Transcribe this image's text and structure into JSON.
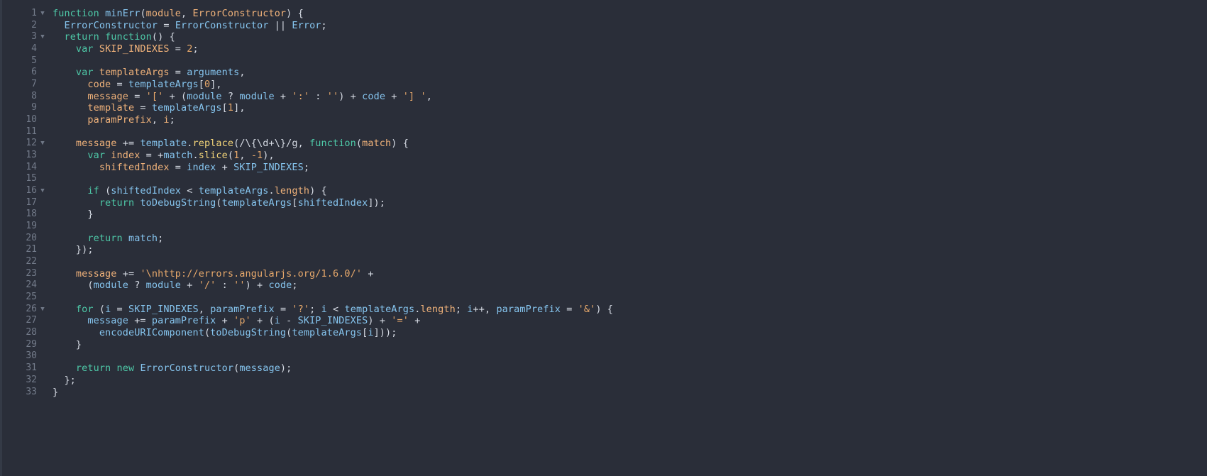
{
  "editor": {
    "language": "javascript",
    "total_lines": 33,
    "colors": {
      "background": "#2a2e39",
      "gutter_edge": "#343a46",
      "line_number": "#737b8a",
      "fold_arrow": "#6f7786",
      "keyword": "#4ec9a8",
      "identifier": "#86c5ef",
      "parameter": "#f0b27a",
      "method": "#f2d479",
      "string": "#e6a86b",
      "number": "#e6a86b",
      "punctuation": "#d6dbe4"
    },
    "fold_arrow_glyph": "▼",
    "folded_lines": [
      1,
      3,
      12,
      16,
      26
    ],
    "lines": [
      {
        "number": "1",
        "fold": true,
        "tokens": [
          {
            "text": "function ",
            "kind": "keyword"
          },
          {
            "text": "minErr",
            "kind": "identifier"
          },
          {
            "text": "(",
            "kind": "punctuation"
          },
          {
            "text": "module",
            "kind": "parameter"
          },
          {
            "text": ", ",
            "kind": "punctuation"
          },
          {
            "text": "ErrorConstructor",
            "kind": "parameter"
          },
          {
            "text": ") {",
            "kind": "punctuation"
          }
        ]
      },
      {
        "number": "2",
        "fold": false,
        "tokens": [
          {
            "text": "  ",
            "kind": "plain"
          },
          {
            "text": "ErrorConstructor",
            "kind": "identifier"
          },
          {
            "text": " = ",
            "kind": "punctuation"
          },
          {
            "text": "ErrorConstructor",
            "kind": "identifier"
          },
          {
            "text": " || ",
            "kind": "punctuation"
          },
          {
            "text": "Error",
            "kind": "identifier"
          },
          {
            "text": ";",
            "kind": "punctuation"
          }
        ]
      },
      {
        "number": "3",
        "fold": true,
        "tokens": [
          {
            "text": "  ",
            "kind": "plain"
          },
          {
            "text": "return ",
            "kind": "keyword"
          },
          {
            "text": "function",
            "kind": "keyword"
          },
          {
            "text": "() {",
            "kind": "punctuation"
          }
        ]
      },
      {
        "number": "4",
        "fold": false,
        "tokens": [
          {
            "text": "    ",
            "kind": "plain"
          },
          {
            "text": "var ",
            "kind": "keyword"
          },
          {
            "text": "SKIP_INDEXES",
            "kind": "parameter"
          },
          {
            "text": " = ",
            "kind": "punctuation"
          },
          {
            "text": "2",
            "kind": "number"
          },
          {
            "text": ";",
            "kind": "punctuation"
          }
        ]
      },
      {
        "number": "5",
        "fold": false,
        "tokens": []
      },
      {
        "number": "6",
        "fold": false,
        "tokens": [
          {
            "text": "    ",
            "kind": "plain"
          },
          {
            "text": "var ",
            "kind": "keyword"
          },
          {
            "text": "templateArgs",
            "kind": "parameter"
          },
          {
            "text": " = ",
            "kind": "punctuation"
          },
          {
            "text": "arguments",
            "kind": "identifier"
          },
          {
            "text": ",",
            "kind": "punctuation"
          }
        ]
      },
      {
        "number": "7",
        "fold": false,
        "tokens": [
          {
            "text": "      ",
            "kind": "plain"
          },
          {
            "text": "code",
            "kind": "parameter"
          },
          {
            "text": " = ",
            "kind": "punctuation"
          },
          {
            "text": "templateArgs",
            "kind": "identifier"
          },
          {
            "text": "[",
            "kind": "punctuation"
          },
          {
            "text": "0",
            "kind": "number"
          },
          {
            "text": "],",
            "kind": "punctuation"
          }
        ]
      },
      {
        "number": "8",
        "fold": false,
        "tokens": [
          {
            "text": "      ",
            "kind": "plain"
          },
          {
            "text": "message",
            "kind": "parameter"
          },
          {
            "text": " = ",
            "kind": "punctuation"
          },
          {
            "text": "'['",
            "kind": "string"
          },
          {
            "text": " + (",
            "kind": "punctuation"
          },
          {
            "text": "module",
            "kind": "identifier"
          },
          {
            "text": " ? ",
            "kind": "punctuation"
          },
          {
            "text": "module",
            "kind": "identifier"
          },
          {
            "text": " + ",
            "kind": "punctuation"
          },
          {
            "text": "':'",
            "kind": "string"
          },
          {
            "text": " : ",
            "kind": "punctuation"
          },
          {
            "text": "''",
            "kind": "string"
          },
          {
            "text": ") + ",
            "kind": "punctuation"
          },
          {
            "text": "code",
            "kind": "identifier"
          },
          {
            "text": " + ",
            "kind": "punctuation"
          },
          {
            "text": "'] '",
            "kind": "string"
          },
          {
            "text": ",",
            "kind": "punctuation"
          }
        ]
      },
      {
        "number": "9",
        "fold": false,
        "tokens": [
          {
            "text": "      ",
            "kind": "plain"
          },
          {
            "text": "template",
            "kind": "parameter"
          },
          {
            "text": " = ",
            "kind": "punctuation"
          },
          {
            "text": "templateArgs",
            "kind": "identifier"
          },
          {
            "text": "[",
            "kind": "punctuation"
          },
          {
            "text": "1",
            "kind": "number"
          },
          {
            "text": "],",
            "kind": "punctuation"
          }
        ]
      },
      {
        "number": "10",
        "fold": false,
        "tokens": [
          {
            "text": "      ",
            "kind": "plain"
          },
          {
            "text": "paramPrefix",
            "kind": "parameter"
          },
          {
            "text": ", ",
            "kind": "punctuation"
          },
          {
            "text": "i",
            "kind": "parameter"
          },
          {
            "text": ";",
            "kind": "punctuation"
          }
        ]
      },
      {
        "number": "11",
        "fold": false,
        "tokens": []
      },
      {
        "number": "12",
        "fold": true,
        "tokens": [
          {
            "text": "    ",
            "kind": "plain"
          },
          {
            "text": "message",
            "kind": "parameter"
          },
          {
            "text": " += ",
            "kind": "punctuation"
          },
          {
            "text": "template",
            "kind": "identifier"
          },
          {
            "text": ".",
            "kind": "punctuation"
          },
          {
            "text": "replace",
            "kind": "method"
          },
          {
            "text": "(/\\{\\d+\\}/g, ",
            "kind": "punctuation"
          },
          {
            "text": "function",
            "kind": "keyword"
          },
          {
            "text": "(",
            "kind": "punctuation"
          },
          {
            "text": "match",
            "kind": "parameter"
          },
          {
            "text": ") {",
            "kind": "punctuation"
          }
        ]
      },
      {
        "number": "13",
        "fold": false,
        "tokens": [
          {
            "text": "      ",
            "kind": "plain"
          },
          {
            "text": "var ",
            "kind": "keyword"
          },
          {
            "text": "index",
            "kind": "parameter"
          },
          {
            "text": " = +",
            "kind": "punctuation"
          },
          {
            "text": "match",
            "kind": "identifier"
          },
          {
            "text": ".",
            "kind": "punctuation"
          },
          {
            "text": "slice",
            "kind": "method"
          },
          {
            "text": "(",
            "kind": "punctuation"
          },
          {
            "text": "1",
            "kind": "number"
          },
          {
            "text": ", ",
            "kind": "punctuation"
          },
          {
            "text": "-1",
            "kind": "number"
          },
          {
            "text": "),",
            "kind": "punctuation"
          }
        ]
      },
      {
        "number": "14",
        "fold": false,
        "tokens": [
          {
            "text": "        ",
            "kind": "plain"
          },
          {
            "text": "shiftedIndex",
            "kind": "parameter"
          },
          {
            "text": " = ",
            "kind": "punctuation"
          },
          {
            "text": "index",
            "kind": "identifier"
          },
          {
            "text": " + ",
            "kind": "punctuation"
          },
          {
            "text": "SKIP_INDEXES",
            "kind": "identifier"
          },
          {
            "text": ";",
            "kind": "punctuation"
          }
        ]
      },
      {
        "number": "15",
        "fold": false,
        "tokens": []
      },
      {
        "number": "16",
        "fold": true,
        "tokens": [
          {
            "text": "      ",
            "kind": "plain"
          },
          {
            "text": "if ",
            "kind": "keyword"
          },
          {
            "text": "(",
            "kind": "punctuation"
          },
          {
            "text": "shiftedIndex",
            "kind": "identifier"
          },
          {
            "text": " < ",
            "kind": "punctuation"
          },
          {
            "text": "templateArgs",
            "kind": "identifier"
          },
          {
            "text": ".",
            "kind": "punctuation"
          },
          {
            "text": "length",
            "kind": "parameter"
          },
          {
            "text": ") {",
            "kind": "punctuation"
          }
        ]
      },
      {
        "number": "17",
        "fold": false,
        "tokens": [
          {
            "text": "        ",
            "kind": "plain"
          },
          {
            "text": "return ",
            "kind": "keyword"
          },
          {
            "text": "toDebugString",
            "kind": "identifier"
          },
          {
            "text": "(",
            "kind": "punctuation"
          },
          {
            "text": "templateArgs",
            "kind": "identifier"
          },
          {
            "text": "[",
            "kind": "punctuation"
          },
          {
            "text": "shiftedIndex",
            "kind": "identifier"
          },
          {
            "text": "]);",
            "kind": "punctuation"
          }
        ]
      },
      {
        "number": "18",
        "fold": false,
        "tokens": [
          {
            "text": "      }",
            "kind": "punctuation"
          }
        ]
      },
      {
        "number": "19",
        "fold": false,
        "tokens": []
      },
      {
        "number": "20",
        "fold": false,
        "tokens": [
          {
            "text": "      ",
            "kind": "plain"
          },
          {
            "text": "return ",
            "kind": "keyword"
          },
          {
            "text": "match",
            "kind": "identifier"
          },
          {
            "text": ";",
            "kind": "punctuation"
          }
        ]
      },
      {
        "number": "21",
        "fold": false,
        "tokens": [
          {
            "text": "    });",
            "kind": "punctuation"
          }
        ]
      },
      {
        "number": "22",
        "fold": false,
        "tokens": []
      },
      {
        "number": "23",
        "fold": false,
        "tokens": [
          {
            "text": "    ",
            "kind": "plain"
          },
          {
            "text": "message",
            "kind": "parameter"
          },
          {
            "text": " += ",
            "kind": "punctuation"
          },
          {
            "text": "'\\nhttp://errors.angularjs.org/1.6.0/'",
            "kind": "string"
          },
          {
            "text": " +",
            "kind": "punctuation"
          }
        ]
      },
      {
        "number": "24",
        "fold": false,
        "tokens": [
          {
            "text": "      (",
            "kind": "punctuation"
          },
          {
            "text": "module",
            "kind": "identifier"
          },
          {
            "text": " ? ",
            "kind": "punctuation"
          },
          {
            "text": "module",
            "kind": "identifier"
          },
          {
            "text": " + ",
            "kind": "punctuation"
          },
          {
            "text": "'/'",
            "kind": "string"
          },
          {
            "text": " : ",
            "kind": "punctuation"
          },
          {
            "text": "''",
            "kind": "string"
          },
          {
            "text": ") + ",
            "kind": "punctuation"
          },
          {
            "text": "code",
            "kind": "identifier"
          },
          {
            "text": ";",
            "kind": "punctuation"
          }
        ]
      },
      {
        "number": "25",
        "fold": false,
        "tokens": []
      },
      {
        "number": "26",
        "fold": true,
        "tokens": [
          {
            "text": "    ",
            "kind": "plain"
          },
          {
            "text": "for ",
            "kind": "keyword"
          },
          {
            "text": "(",
            "kind": "punctuation"
          },
          {
            "text": "i",
            "kind": "identifier"
          },
          {
            "text": " = ",
            "kind": "punctuation"
          },
          {
            "text": "SKIP_INDEXES",
            "kind": "identifier"
          },
          {
            "text": ", ",
            "kind": "punctuation"
          },
          {
            "text": "paramPrefix",
            "kind": "identifier"
          },
          {
            "text": " = ",
            "kind": "punctuation"
          },
          {
            "text": "'?'",
            "kind": "string"
          },
          {
            "text": "; ",
            "kind": "punctuation"
          },
          {
            "text": "i",
            "kind": "identifier"
          },
          {
            "text": " < ",
            "kind": "punctuation"
          },
          {
            "text": "templateArgs",
            "kind": "identifier"
          },
          {
            "text": ".",
            "kind": "punctuation"
          },
          {
            "text": "length",
            "kind": "parameter"
          },
          {
            "text": "; ",
            "kind": "punctuation"
          },
          {
            "text": "i",
            "kind": "identifier"
          },
          {
            "text": "++, ",
            "kind": "punctuation"
          },
          {
            "text": "paramPrefix",
            "kind": "identifier"
          },
          {
            "text": " = ",
            "kind": "punctuation"
          },
          {
            "text": "'&'",
            "kind": "string"
          },
          {
            "text": ") {",
            "kind": "punctuation"
          }
        ]
      },
      {
        "number": "27",
        "fold": false,
        "tokens": [
          {
            "text": "      ",
            "kind": "plain"
          },
          {
            "text": "message",
            "kind": "identifier"
          },
          {
            "text": " += ",
            "kind": "punctuation"
          },
          {
            "text": "paramPrefix",
            "kind": "identifier"
          },
          {
            "text": " + ",
            "kind": "punctuation"
          },
          {
            "text": "'p'",
            "kind": "string"
          },
          {
            "text": " + (",
            "kind": "punctuation"
          },
          {
            "text": "i",
            "kind": "identifier"
          },
          {
            "text": " - ",
            "kind": "punctuation"
          },
          {
            "text": "SKIP_INDEXES",
            "kind": "identifier"
          },
          {
            "text": ") + ",
            "kind": "punctuation"
          },
          {
            "text": "'='",
            "kind": "string"
          },
          {
            "text": " +",
            "kind": "punctuation"
          }
        ]
      },
      {
        "number": "28",
        "fold": false,
        "tokens": [
          {
            "text": "        ",
            "kind": "plain"
          },
          {
            "text": "encodeURIComponent",
            "kind": "identifier"
          },
          {
            "text": "(",
            "kind": "punctuation"
          },
          {
            "text": "toDebugString",
            "kind": "identifier"
          },
          {
            "text": "(",
            "kind": "punctuation"
          },
          {
            "text": "templateArgs",
            "kind": "identifier"
          },
          {
            "text": "[",
            "kind": "punctuation"
          },
          {
            "text": "i",
            "kind": "identifier"
          },
          {
            "text": "]));",
            "kind": "punctuation"
          }
        ]
      },
      {
        "number": "29",
        "fold": false,
        "tokens": [
          {
            "text": "    }",
            "kind": "punctuation"
          }
        ]
      },
      {
        "number": "30",
        "fold": false,
        "tokens": []
      },
      {
        "number": "31",
        "fold": false,
        "tokens": [
          {
            "text": "    ",
            "kind": "plain"
          },
          {
            "text": "return new ",
            "kind": "keyword"
          },
          {
            "text": "ErrorConstructor",
            "kind": "identifier"
          },
          {
            "text": "(",
            "kind": "punctuation"
          },
          {
            "text": "message",
            "kind": "identifier"
          },
          {
            "text": ");",
            "kind": "punctuation"
          }
        ]
      },
      {
        "number": "32",
        "fold": false,
        "tokens": [
          {
            "text": "  };",
            "kind": "punctuation"
          }
        ]
      },
      {
        "number": "33",
        "fold": false,
        "tokens": [
          {
            "text": "}",
            "kind": "punctuation"
          }
        ]
      }
    ]
  }
}
